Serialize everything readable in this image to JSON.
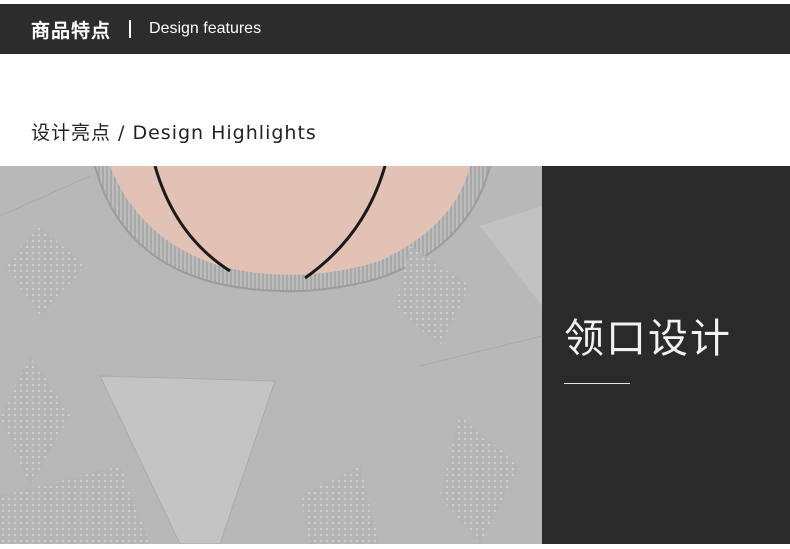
{
  "header": {
    "title_cn": "商品特点",
    "title_en": "Design features"
  },
  "section": {
    "heading": "设计亮点 / Design Highlights"
  },
  "feature": {
    "title": "领口设计"
  },
  "colors": {
    "header_bg": "#2c2c2c",
    "panel_bg": "#2a2a2a",
    "sweater_gray": "#b9b9b9",
    "skin": "#e2c2b4"
  }
}
